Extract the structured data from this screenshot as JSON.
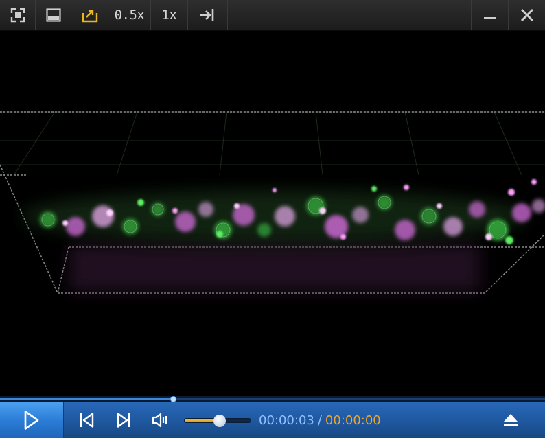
{
  "toolbar": {
    "speed_half_label": "0.5x",
    "speed_normal_label": "1x",
    "icons": [
      "fullscreen-icon",
      "mini-mode-icon",
      "open-file-icon",
      "pin-icon",
      "minimize-icon",
      "close-icon"
    ]
  },
  "playback": {
    "current_time": "00:00:03",
    "separator": "/",
    "total_time": "00:00:00",
    "seek_fraction": 0.317,
    "volume_fraction": 0.53
  },
  "colors": {
    "toolbar_bg": "#262626",
    "control_bar": "#1e569c",
    "time_current": "#8fc1ff",
    "time_total": "#f0a626",
    "open_icon": "#e8b820",
    "fluor_green": "#3fd24a",
    "fluor_magenta": "#e070e8"
  },
  "controls": {
    "icons": [
      "play-icon",
      "previous-icon",
      "next-icon",
      "volume-icon",
      "eject-icon"
    ]
  }
}
